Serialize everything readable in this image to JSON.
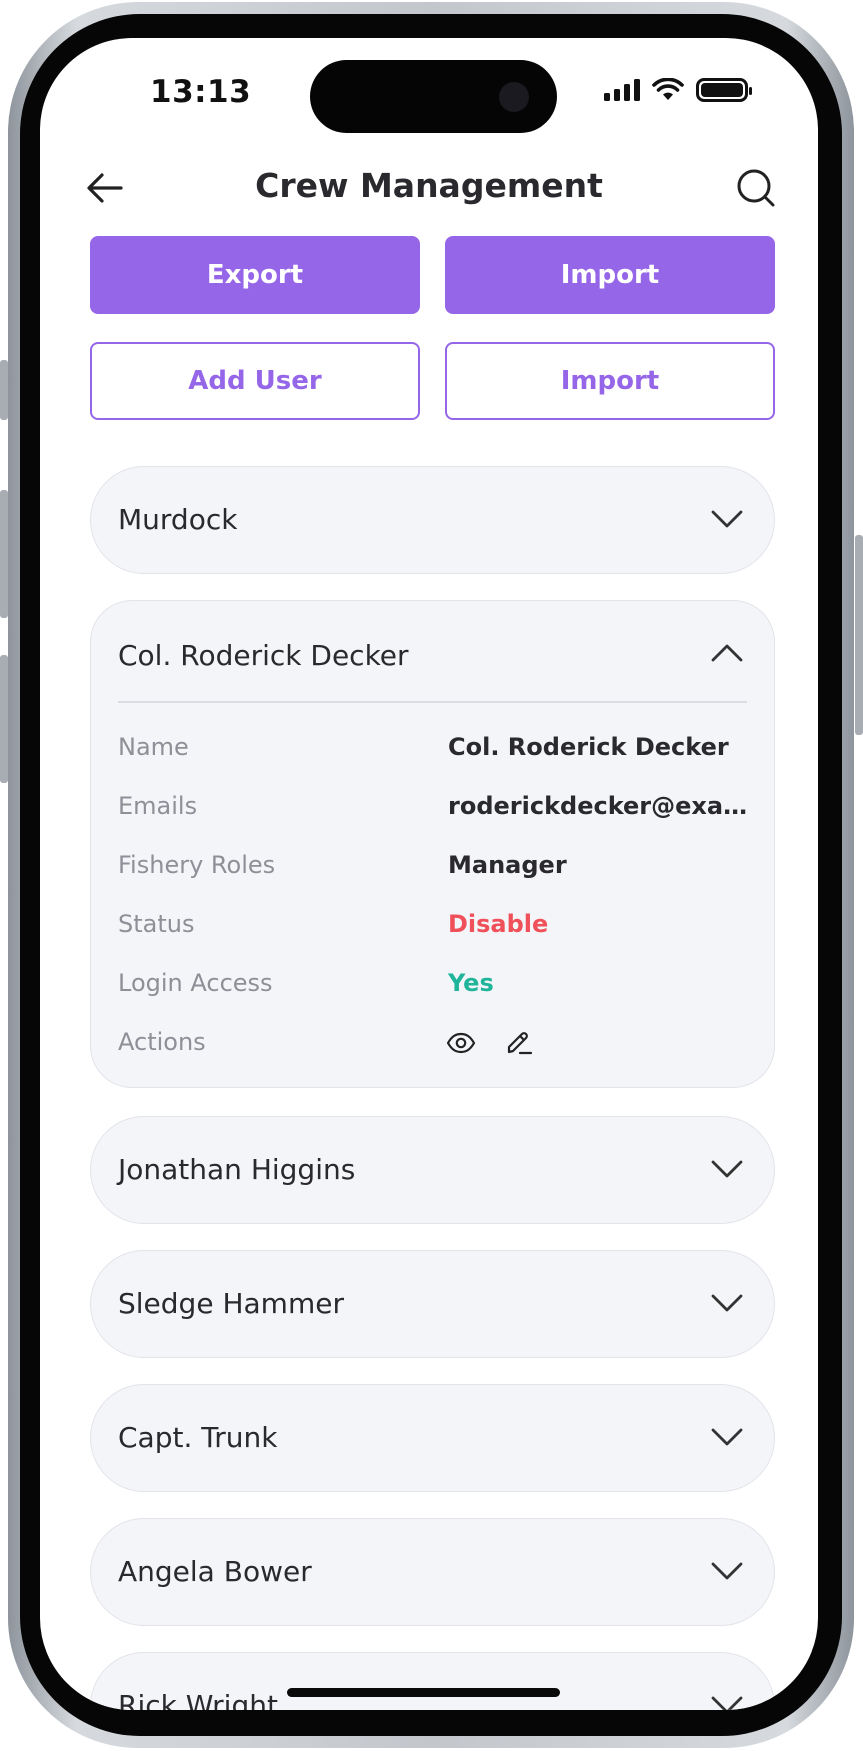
{
  "status_bar": {
    "time": "13:13"
  },
  "header": {
    "title": "Crew Management"
  },
  "buttons": {
    "export": "Export",
    "import_primary": "Import",
    "add_user": "Add User",
    "import_secondary": "Import"
  },
  "crew": [
    {
      "name": "Murdock",
      "expanded": false
    },
    {
      "name": "Col. Roderick Decker",
      "expanded": true,
      "details": {
        "name_label": "Name",
        "name_value": "Col. Roderick Decker",
        "emails_label": "Emails",
        "emails_value": "roderickdecker@exampl...",
        "roles_label": "Fishery Roles",
        "roles_value": "Manager",
        "status_label": "Status",
        "status_value": "Disable",
        "login_label": "Login Access",
        "login_value": "Yes",
        "actions_label": "Actions"
      }
    },
    {
      "name": "Jonathan Higgins",
      "expanded": false
    },
    {
      "name": "Sledge Hammer",
      "expanded": false
    },
    {
      "name": "Capt. Trunk",
      "expanded": false
    },
    {
      "name": "Angela Bower",
      "expanded": false
    },
    {
      "name": "Rick Wright",
      "expanded": false
    }
  ],
  "colors": {
    "accent": "#9566e8",
    "status_disable": "#f0505a",
    "login_yes": "#20b59a",
    "card_bg": "#f4f5f9"
  },
  "icons": [
    "back-arrow-icon",
    "search-icon",
    "chevron-down-icon",
    "chevron-up-icon",
    "eye-icon",
    "edit-pencil-icon"
  ]
}
